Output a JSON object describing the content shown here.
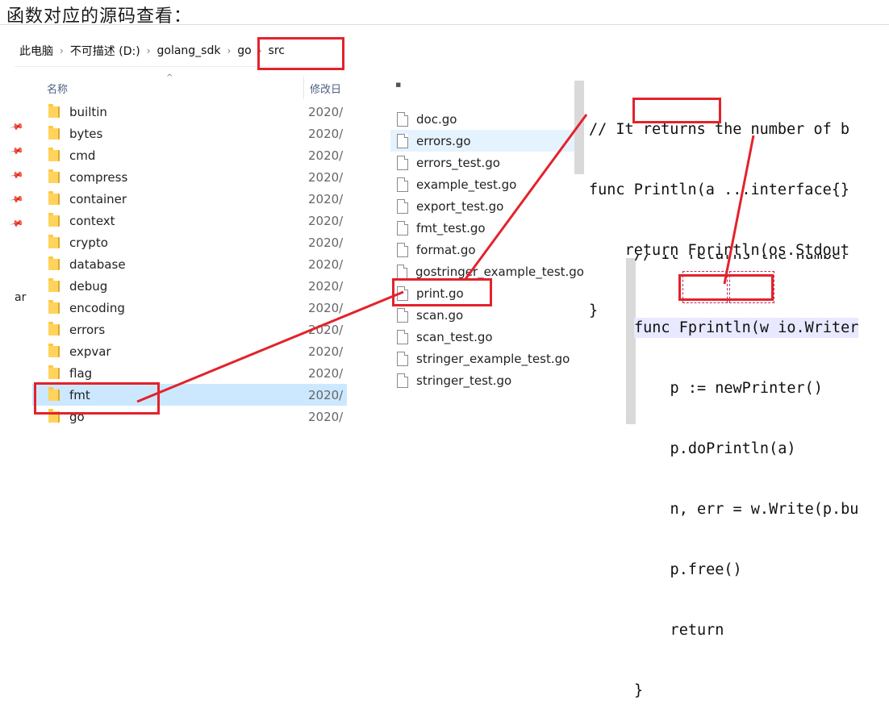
{
  "heading": "函数对应的源码查看：",
  "breadcrumb": [
    "此电脑",
    "不可描述 (D:)",
    "golang_sdk",
    "go",
    "src"
  ],
  "explorer": {
    "col_name": "名称",
    "col_date": "修改日",
    "side_text": "ar",
    "folders": [
      {
        "name": "builtin",
        "date": "2020/"
      },
      {
        "name": "bytes",
        "date": "2020/"
      },
      {
        "name": "cmd",
        "date": "2020/"
      },
      {
        "name": "compress",
        "date": "2020/"
      },
      {
        "name": "container",
        "date": "2020/"
      },
      {
        "name": "context",
        "date": "2020/"
      },
      {
        "name": "crypto",
        "date": "2020/"
      },
      {
        "name": "database",
        "date": "2020/"
      },
      {
        "name": "debug",
        "date": "2020/"
      },
      {
        "name": "encoding",
        "date": "2020/"
      },
      {
        "name": "errors",
        "date": "2020/"
      },
      {
        "name": "expvar",
        "date": "2020/"
      },
      {
        "name": "flag",
        "date": "2020/"
      },
      {
        "name": "fmt",
        "date": "2020/"
      },
      {
        "name": "go",
        "date": "2020/"
      }
    ]
  },
  "files": [
    "doc.go",
    "errors.go",
    "errors_test.go",
    "example_test.go",
    "export_test.go",
    "fmt_test.go",
    "format.go",
    "gostringer_example_test.go",
    "print.go",
    "scan.go",
    "scan_test.go",
    "stringer_example_test.go",
    "stringer_test.go"
  ],
  "code1": [
    "// It returns the number of b",
    "func Println(a ...interface{}",
    "    return Fprintln(os.Stdout",
    "}"
  ],
  "code2_cut": "// It returns the number",
  "code2": [
    "func Fprintln(w io.Writer",
    "    p := newPrinter()",
    "    p.doPrintln(a)",
    "    n, err = w.Write(p.bu",
    "    p.free()",
    "    return",
    "}"
  ],
  "colors": {
    "annotation": "#e3222b",
    "selected": "#cce8ff",
    "hover": "#e5f3ff"
  }
}
